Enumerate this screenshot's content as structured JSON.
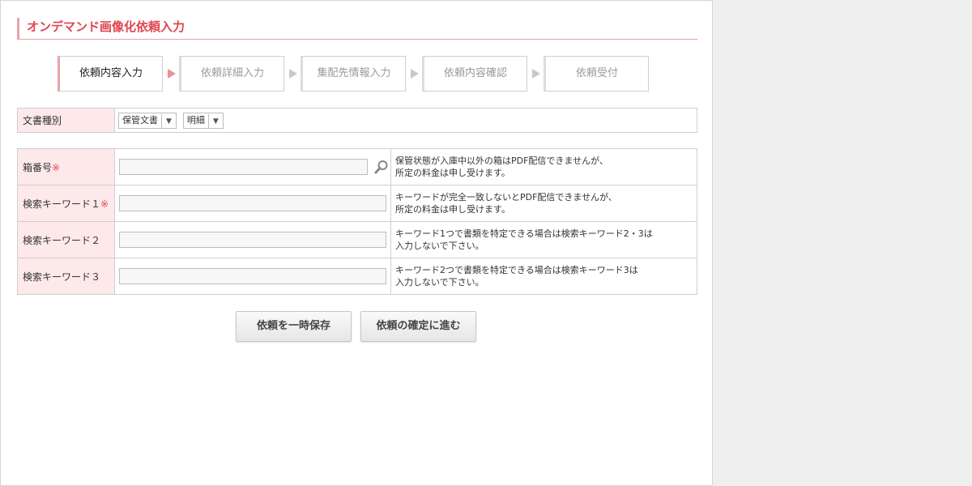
{
  "page_title": "オンデマンド画像化依頼入力",
  "steps": [
    {
      "label": "依頼内容入力",
      "active": true
    },
    {
      "label": "依頼詳細入力",
      "active": false
    },
    {
      "label": "集配先情報入力",
      "active": false
    },
    {
      "label": "依頼内容確認",
      "active": false
    },
    {
      "label": "依頼受付",
      "active": false
    }
  ],
  "doc_type": {
    "label": "文書種別",
    "select1": "保管文書",
    "select2": "明細"
  },
  "fields": [
    {
      "label": "箱番号",
      "required_mark": "※",
      "value": "",
      "note_line1": "保管状態が入庫中以外の箱はPDF配信できませんが、",
      "note_line2": "所定の料金は申し受けます。"
    },
    {
      "label": "検索キーワード１",
      "required_mark": "※",
      "value": "",
      "note_line1": "キーワードが完全一致しないとPDF配信できませんが、",
      "note_line2": "所定の料金は申し受けます。"
    },
    {
      "label": "検索キーワード２",
      "required_mark": "",
      "value": "",
      "note_line1": "キーワード1つで書類を特定できる場合は検索キーワード2・3は",
      "note_line2": "入力しないで下さい。"
    },
    {
      "label": "検索キーワード３",
      "required_mark": "",
      "value": "",
      "note_line1": "キーワード2つで書類を特定できる場合は検索キーワード3は",
      "note_line2": "入力しないで下さい。"
    }
  ],
  "buttons": {
    "save": "依頼を一時保存",
    "next": "依頼の確定に進む"
  },
  "colors": {
    "accent": "#e0454f",
    "header_cell": "#fde8ea",
    "background": "#efefef"
  }
}
